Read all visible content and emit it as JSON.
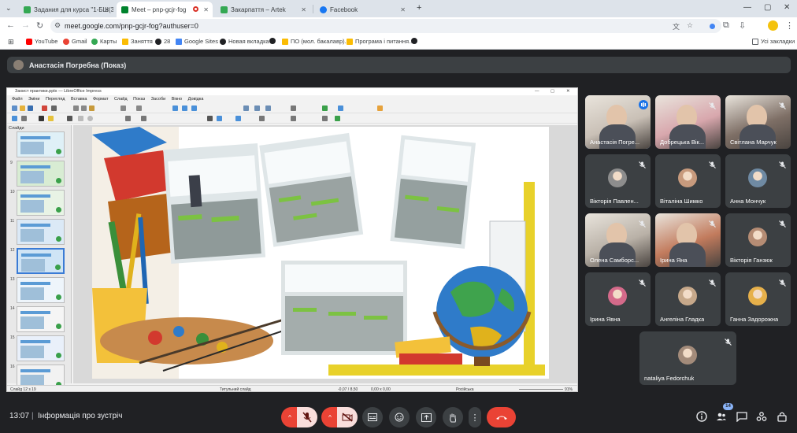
{
  "browser": {
    "tabs": [
      {
        "title": "Задания для курса \"1-БШ(3), \"",
        "active": false,
        "favicon_color": "#34a853"
      },
      {
        "title": "Meet – pnp-gcjr-fog",
        "active": true,
        "favicon_color": "#00832d"
      },
      {
        "title": "Закарпаття – Artek",
        "active": false,
        "favicon_color": "#34a853"
      },
      {
        "title": "Facebook",
        "active": false,
        "favicon_color": "#1877f2"
      }
    ],
    "new_tab": "+",
    "url": "meet.google.com/pnp-gcjr-fog?authuser=0",
    "bookmarks": [
      {
        "label": "YouTube",
        "color": "#ff0000"
      },
      {
        "label": "Gmail",
        "color": "#ea4335"
      },
      {
        "label": "Карты",
        "color": "#34a853"
      },
      {
        "label": "Заняття",
        "color": "#fbbc04"
      },
      {
        "label": "28",
        "color": "#202124"
      },
      {
        "label": "Google Sites",
        "color": "#4285f4"
      },
      {
        "label": "Новая вкладка",
        "color": "#202124"
      },
      {
        "label": "",
        "color": "#202124"
      },
      {
        "label": "ПО (мол. бакалавр)...",
        "color": "#fbbc04"
      },
      {
        "label": "Програма і питання...",
        "color": "#fbbc04"
      },
      {
        "label": "",
        "color": "#202124"
      }
    ],
    "all_bookmarks": "Усі закладки"
  },
  "meet": {
    "presenter_label": "Анастасія Погребна (Показ)",
    "clock": "13:07",
    "separator": "|",
    "meeting_info": "Інформація про зустріч",
    "participant_count": "14",
    "participants": [
      {
        "name": "Анастасія Погре...",
        "kind": "video",
        "color": "#c9c0b6",
        "speaking": true
      },
      {
        "name": "Добрецька Вік...",
        "kind": "video",
        "color": "#d8a7ad",
        "speaking": false
      },
      {
        "name": "Світлана Марчук",
        "kind": "video",
        "color": "#7e6f66",
        "speaking": false
      },
      {
        "name": "Вікторія Павлен...",
        "kind": "avatar",
        "color": "#8d8d8d",
        "speaking": false
      },
      {
        "name": "Віталіна Шимко",
        "kind": "avatar",
        "color": "#c79a7d",
        "speaking": false
      },
      {
        "name": "Анна Мончук",
        "kind": "avatar",
        "color": "#6f8aa3",
        "speaking": false
      },
      {
        "name": "Олена Самборс...",
        "kind": "video",
        "color": "#b9b1a7",
        "speaking": false
      },
      {
        "name": "Ірина Яна",
        "kind": "video",
        "color": "#c27b5d",
        "speaking": false
      },
      {
        "name": "Вікторія Ганзюк",
        "kind": "avatar",
        "color": "#b58c74",
        "speaking": false
      },
      {
        "name": "Ірина Явна",
        "kind": "avatar",
        "color": "#d46a8a",
        "speaking": false
      },
      {
        "name": "Ангеліна Гладка",
        "kind": "avatar",
        "color": "#c6a88a",
        "speaking": false
      },
      {
        "name": "Ганна Задорожна",
        "kind": "avatar",
        "color": "#e6b04a",
        "speaking": false
      },
      {
        "name": "nataliya Fedorchuk",
        "kind": "avatar",
        "color": "#a38b7a",
        "speaking": false
      }
    ]
  },
  "impress": {
    "title": "Захист практики.pptx — LibreOffice Impress",
    "menu": [
      "Файл",
      "Зміни",
      "Перегляд",
      "Вставка",
      "Формат",
      "Слайд",
      "Показ",
      "Засоби",
      "Вікно",
      "Довідка"
    ],
    "slides_header": "Слайди",
    "thumbnails": [
      "",
      "9",
      "10",
      "11",
      "12",
      "13",
      "14",
      "15",
      "16"
    ],
    "status": {
      "slide": "Слайд 12 з 19",
      "layout": "Титульний слайд",
      "position": "-0,07 / 8,50",
      "size": "0,00 x 0,00",
      "language": "Російська",
      "zoom": "91%"
    }
  }
}
